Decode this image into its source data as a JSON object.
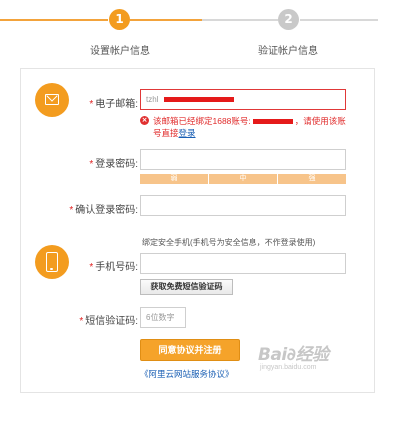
{
  "steps": [
    {
      "number": "1",
      "label": "设置帐户信息",
      "state": "active"
    },
    {
      "number": "2",
      "label": "验证帐户信息",
      "state": "inactive"
    }
  ],
  "colors": {
    "accent": "#f39c1f",
    "error": "#e02a2a",
    "link": "#1a5fb4"
  },
  "email": {
    "label": "电子邮箱:",
    "value": "tzhl",
    "error_text": "该邮箱已经绑定1688账号:",
    "error_tail": "，请使用该账号直接",
    "error_link": "登录",
    "icon": "mail-icon"
  },
  "password": {
    "label": "登录密码:",
    "strength": [
      "弱",
      "中",
      "强"
    ]
  },
  "confirm_password": {
    "label": "确认登录密码:"
  },
  "phone": {
    "hint": "绑定安全手机(手机号为安全信息，不作登录使用)",
    "label": "手机号码:",
    "icon": "phone-icon",
    "sms_button": "获取免费短信验证码"
  },
  "sms_code": {
    "label": "短信验证码:",
    "placeholder": "6位数字"
  },
  "submit_label": "同意协议并注册",
  "agreement_link": "《阿里云网站服务协议》",
  "watermark": {
    "main": "Bai∂经验",
    "sub": "jingyan.baidu.com"
  }
}
